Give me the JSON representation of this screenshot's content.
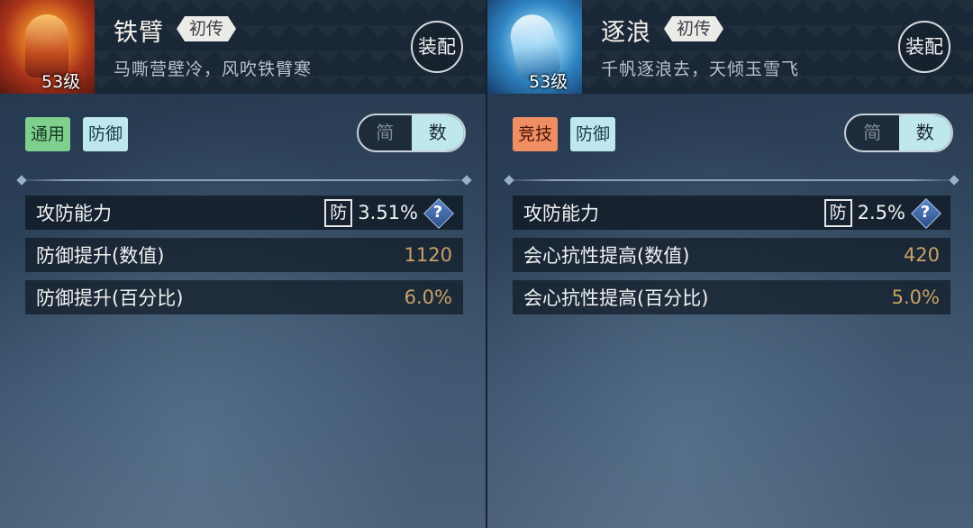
{
  "cards": [
    {
      "name": "铁臂",
      "rarity": "初传",
      "motto": "马嘶营壁冷，风吹铁臂寒",
      "level": "53级",
      "equip_label": "装配",
      "tags": [
        "通用",
        "防御"
      ],
      "toggle": {
        "options": [
          "简",
          "数"
        ],
        "selected": "数"
      },
      "main_stat": {
        "label": "攻防能力",
        "badge": "防",
        "value": "3.51%",
        "help": "?"
      },
      "stats": [
        {
          "label": "防御提升(数值)",
          "value": "1120"
        },
        {
          "label": "防御提升(百分比)",
          "value": "6.0%"
        }
      ]
    },
    {
      "name": "逐浪",
      "rarity": "初传",
      "motto": "千帆逐浪去，天倾玉雪飞",
      "level": "53级",
      "equip_label": "装配",
      "tags": [
        "竞技",
        "防御"
      ],
      "toggle": {
        "options": [
          "简",
          "数"
        ],
        "selected": "数"
      },
      "main_stat": {
        "label": "攻防能力",
        "badge": "防",
        "value": "2.5%",
        "help": "?"
      },
      "stats": [
        {
          "label": "会心抗性提高(数值)",
          "value": "420"
        },
        {
          "label": "会心抗性提高(百分比)",
          "value": "5.0%"
        }
      ]
    }
  ],
  "colors": {
    "tag_general": "#7fcf8e",
    "tag_arena": "#ee8e62",
    "tag_defense": "#bfe8ee",
    "stat_value": "#c7a169"
  }
}
